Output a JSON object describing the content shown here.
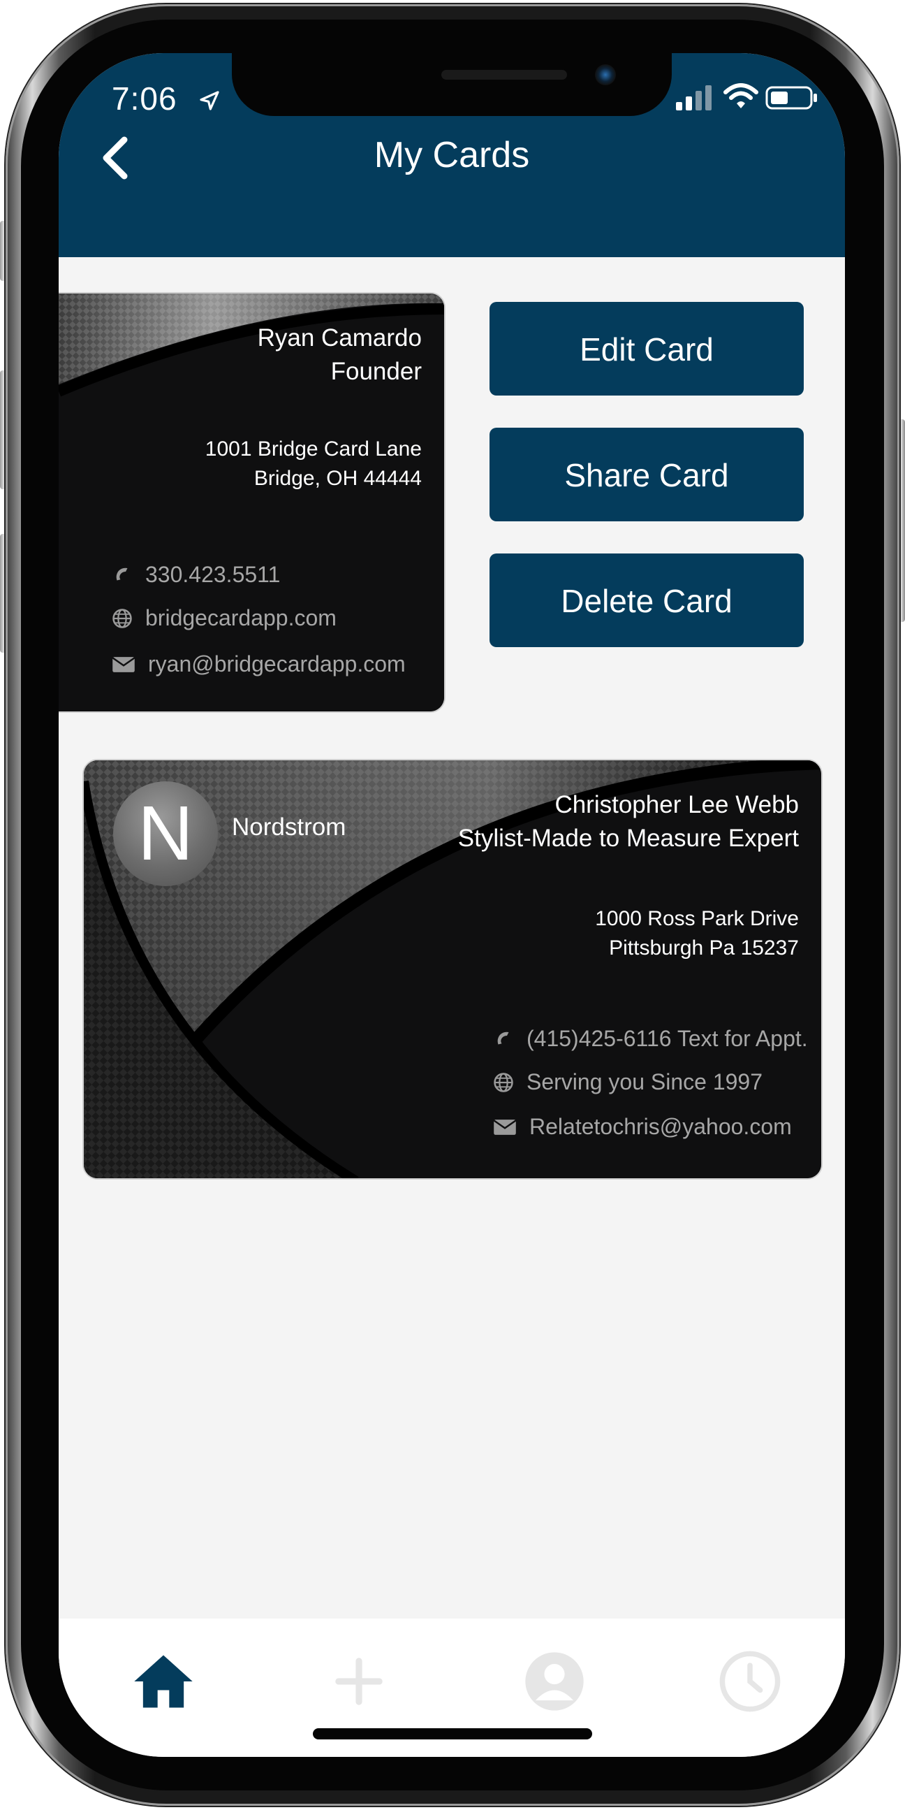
{
  "status_bar": {
    "time": "7:06"
  },
  "header": {
    "title": "My Cards"
  },
  "colors": {
    "brand": "#043c5c",
    "background": "#f4f4f4",
    "card": "#0f0f10",
    "muted_text": "#a7a7a7",
    "inactive_tab": "#e6e6e6"
  },
  "card_actions": {
    "edit": "Edit Card",
    "share": "Share Card",
    "delete": "Delete Card"
  },
  "cards": [
    {
      "name": "Ryan Camardo",
      "title": "Founder",
      "address_line1": "1001 Bridge Card Lane",
      "address_line2": "Bridge, OH 44444",
      "phone": "330.423.5511",
      "website": "bridgecardapp.com",
      "email": "ryan@bridgecardapp.com"
    },
    {
      "logo_letter": "N",
      "company": "Nordstrom",
      "name": "Christopher Lee Webb",
      "title": "Stylist-Made to Measure Expert",
      "address_line1": "1000 Ross Park Drive",
      "address_line2": "Pittsburgh Pa 15237",
      "phone": "(415)425-6116 Text for Appt.",
      "website": "Serving you Since 1997",
      "email": "Relatetochris@yahoo.com"
    }
  ],
  "tab_bar": {
    "items": [
      {
        "icon": "home-icon",
        "active": true
      },
      {
        "icon": "plus-icon",
        "active": false
      },
      {
        "icon": "profile-icon",
        "active": false
      },
      {
        "icon": "clock-icon",
        "active": false
      }
    ]
  }
}
